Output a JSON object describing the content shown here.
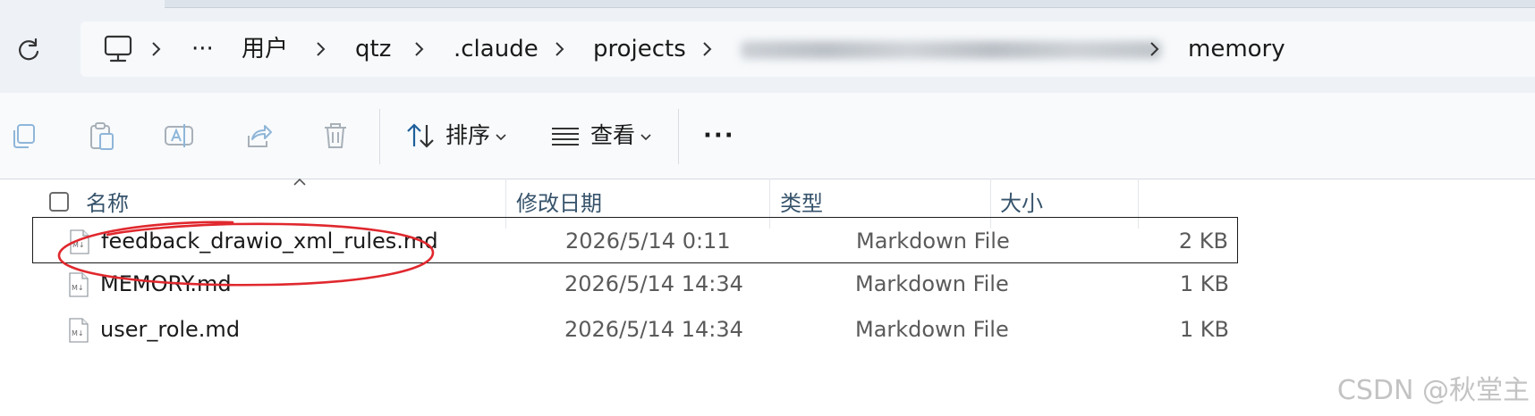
{
  "address_bar": {
    "crumbs": [
      {
        "id": "ellipsis",
        "label": "···"
      },
      {
        "id": "users",
        "label": "用户"
      },
      {
        "id": "qtz",
        "label": "qtz"
      },
      {
        "id": "claude",
        "label": ".claude"
      },
      {
        "id": "projects",
        "label": "projects"
      },
      {
        "id": "memory",
        "label": "memory"
      }
    ]
  },
  "toolbar": {
    "sort_label": "排序",
    "view_label": "查看",
    "more_label": "···"
  },
  "columns": {
    "name": "名称",
    "date": "修改日期",
    "type": "类型",
    "size": "大小"
  },
  "files": [
    {
      "name": "feedback_drawio_xml_rules.md",
      "date": "2026/5/14 0:11",
      "type": "Markdown File",
      "size": "2 KB",
      "selected": true
    },
    {
      "name": "MEMORY.md",
      "date": "2026/5/14 14:34",
      "type": "Markdown File",
      "size": "1 KB",
      "selected": false
    },
    {
      "name": "user_role.md",
      "date": "2026/5/14 14:34",
      "type": "Markdown File",
      "size": "1 KB",
      "selected": false
    }
  ],
  "icons": {
    "refresh": "refresh-icon",
    "pc": "computer-icon",
    "copy": "copy-icon",
    "paste": "paste-icon",
    "rename": "rename-icon",
    "share": "share-icon",
    "delete": "delete-icon",
    "sort": "sort-icon",
    "view": "view-list-icon",
    "markdown_file": "markdown-file-icon"
  },
  "watermark": "CSDN @秋堂主",
  "colors": {
    "annotation": "#e0282e",
    "accent": "#36536b",
    "toolbar_bg": "#f8fafc",
    "addr_bg": "#eef2f7"
  }
}
